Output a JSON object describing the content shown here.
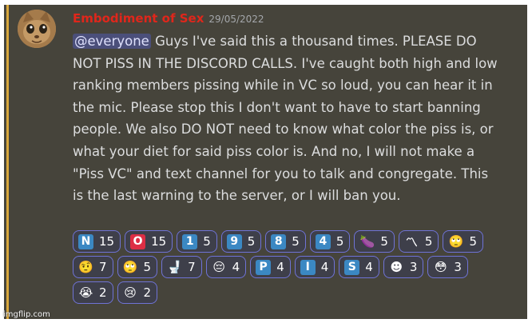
{
  "message": {
    "username": "Embodiment of Sex",
    "timestamp": "29/05/2022",
    "mention": "@everyone",
    "text": " Guys I've said this a thousand times. PLEASE DO NOT PISS IN THE DISCORD CALLS. I've caught both high and low ranking members pissing while in VC so loud, you can hear it in the mic. Please stop this I don't want to have to start banning people. We also DO NOT need to know what color the piss is, or what your diet for said piss color is. And no, I will not make a \"Piss VC\" and text channel for you to talk and congregate. This is the last warning to the server, or I will ban you."
  },
  "reactions": [
    {
      "glyph": "N",
      "icon": "regional-n-icon",
      "count": "15",
      "color": "#3b88c3"
    },
    {
      "glyph": "O",
      "icon": "o-button-icon",
      "count": "15",
      "color": "#dd2e44"
    },
    {
      "glyph": "1",
      "icon": "keycap-1-icon",
      "count": "5",
      "color": "#3b88c3"
    },
    {
      "glyph": "9",
      "icon": "keycap-9-icon",
      "count": "5",
      "color": "#3b88c3"
    },
    {
      "glyph": "8",
      "icon": "keycap-8-icon",
      "count": "5",
      "color": "#3b88c3"
    },
    {
      "glyph": "4",
      "icon": "keycap-4-icon",
      "count": "5",
      "color": "#3b88c3"
    },
    {
      "glyph": "🍆",
      "icon": "eggplant-icon",
      "count": "5",
      "color": "#744eaa"
    },
    {
      "glyph": "〽",
      "icon": "part-alternation-mark-icon",
      "count": "5",
      "color": "#f4a51c"
    },
    {
      "glyph": "🙄",
      "icon": "eye-roll-face-icon",
      "count": "5",
      "color": "#f3c333"
    },
    {
      "glyph": "🤨",
      "icon": "raised-eyebrow-face-icon",
      "count": "7",
      "color": "#f3c333"
    },
    {
      "glyph": "🙄",
      "icon": "eye-roll-face-2-icon",
      "count": "5",
      "color": "#f3c333"
    },
    {
      "glyph": "🚽",
      "icon": "toilet-icon",
      "count": "7",
      "color": "#ccd6dd"
    },
    {
      "glyph": "😔",
      "icon": "pensive-face-icon",
      "count": "4",
      "color": "#f3c333"
    },
    {
      "glyph": "P",
      "icon": "regional-p-icon",
      "count": "4",
      "color": "#3b88c3"
    },
    {
      "glyph": "I",
      "icon": "regional-i-icon",
      "count": "4",
      "color": "#3b88c3"
    },
    {
      "glyph": "S",
      "icon": "regional-s-icon",
      "count": "4",
      "color": "#3b88c3"
    },
    {
      "glyph": "☻",
      "icon": "custom-meme-emoji-icon",
      "count": "3",
      "color": "#222222"
    },
    {
      "glyph": "😳",
      "icon": "flushed-face-icon",
      "count": "3",
      "color": "#f3c333"
    },
    {
      "glyph": "😭",
      "icon": "loudly-crying-face-icon",
      "count": "2",
      "color": "#f3c333"
    },
    {
      "glyph": "😢",
      "icon": "crying-face-icon",
      "count": "2",
      "color": "#f3c333"
    }
  ],
  "watermark": "imgflip.com"
}
